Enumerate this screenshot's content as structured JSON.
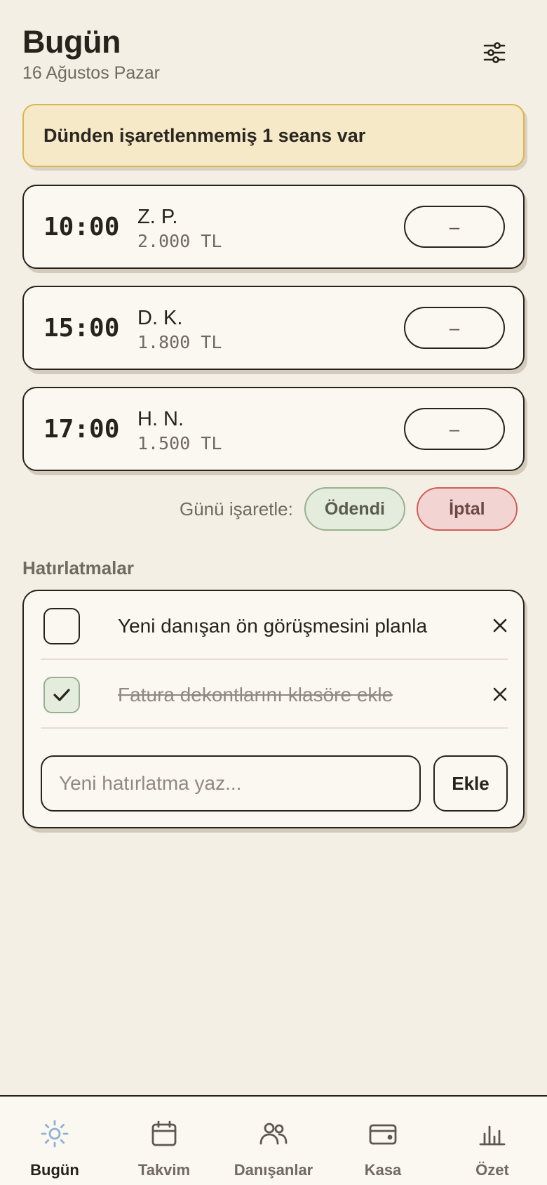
{
  "header": {
    "title": "Bugün",
    "date": "16 Ağustos Pazar"
  },
  "banner": {
    "text": "Dünden işaretlenmemiş 1 seans var"
  },
  "sessions": [
    {
      "time": "10:00",
      "client": "Z. P.",
      "price": "2.000 TL",
      "status": "–"
    },
    {
      "time": "15:00",
      "client": "D. K.",
      "price": "1.800 TL",
      "status": "–"
    },
    {
      "time": "17:00",
      "client": "H. N.",
      "price": "1.500 TL",
      "status": "–"
    }
  ],
  "mark_day": {
    "label": "Günü işaretle:",
    "paid": "Ödendi",
    "cancel": "İptal"
  },
  "reminders": {
    "title": "Hatırlatmalar",
    "items": [
      {
        "text": "Yeni danışan ön görüşmesini planla",
        "done": false
      },
      {
        "text": "Fatura dekontlarını klasöre ekle",
        "done": true
      }
    ],
    "input_placeholder": "Yeni hatırlatma yaz...",
    "add_label": "Ekle"
  },
  "tabs": [
    {
      "label": "Bugün",
      "icon": "sun-icon",
      "active": true
    },
    {
      "label": "Takvim",
      "icon": "calendar-icon",
      "active": false
    },
    {
      "label": "Danışanlar",
      "icon": "users-icon",
      "active": false
    },
    {
      "label": "Kasa",
      "icon": "wallet-icon",
      "active": false
    },
    {
      "label": "Özet",
      "icon": "bar-chart-icon",
      "active": false
    }
  ],
  "colors": {
    "background": "#f4efe4",
    "card": "#fbf8f1",
    "ink": "#26221c",
    "banner_bg": "#f6e9c8",
    "banner_border": "#dcb451",
    "paid_bg": "#e3ecdd",
    "cancel_bg": "#f2d5d2",
    "active_tab_icon": "#8fb0d6"
  }
}
